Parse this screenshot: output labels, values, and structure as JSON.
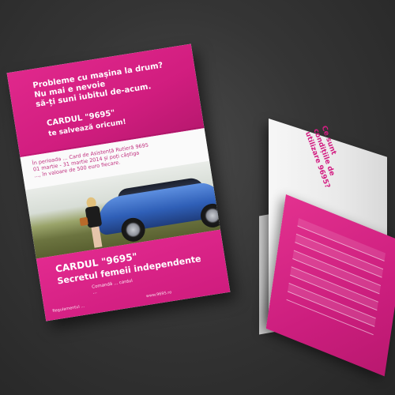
{
  "front_panel": {
    "headline_lines": [
      "Probleme cu mașina la drum?",
      "Nu mai e nevoie",
      "să-ți suni iubitul de-acum."
    ],
    "card_name": "CARDUL \"9695\"",
    "card_subtitle": "te salvează oricum!",
    "promo_lines": [
      "În perioada ... Card de Asistență Rutieră 9695",
      "01 martie - 31 martie 2014 și poți câștiga",
      "..., în valoare de 500 euro fiecare."
    ],
    "bottom_card_name": "CARDUL \"9695\"",
    "bottom_tagline": "Secretul femeii independente",
    "info_lines": [
      "Comandă ... cardul",
      "..."
    ],
    "footer_note": "Regulamentul ...",
    "website": "www.9695.ro"
  },
  "open_brochure": {
    "question_lines": [
      "Ce sunt condițiile de",
      "utilizare 9695?"
    ]
  },
  "colors": {
    "brand_pink": "#d11d7f",
    "background": "#353535",
    "car_blue": "#2f5fb7"
  }
}
